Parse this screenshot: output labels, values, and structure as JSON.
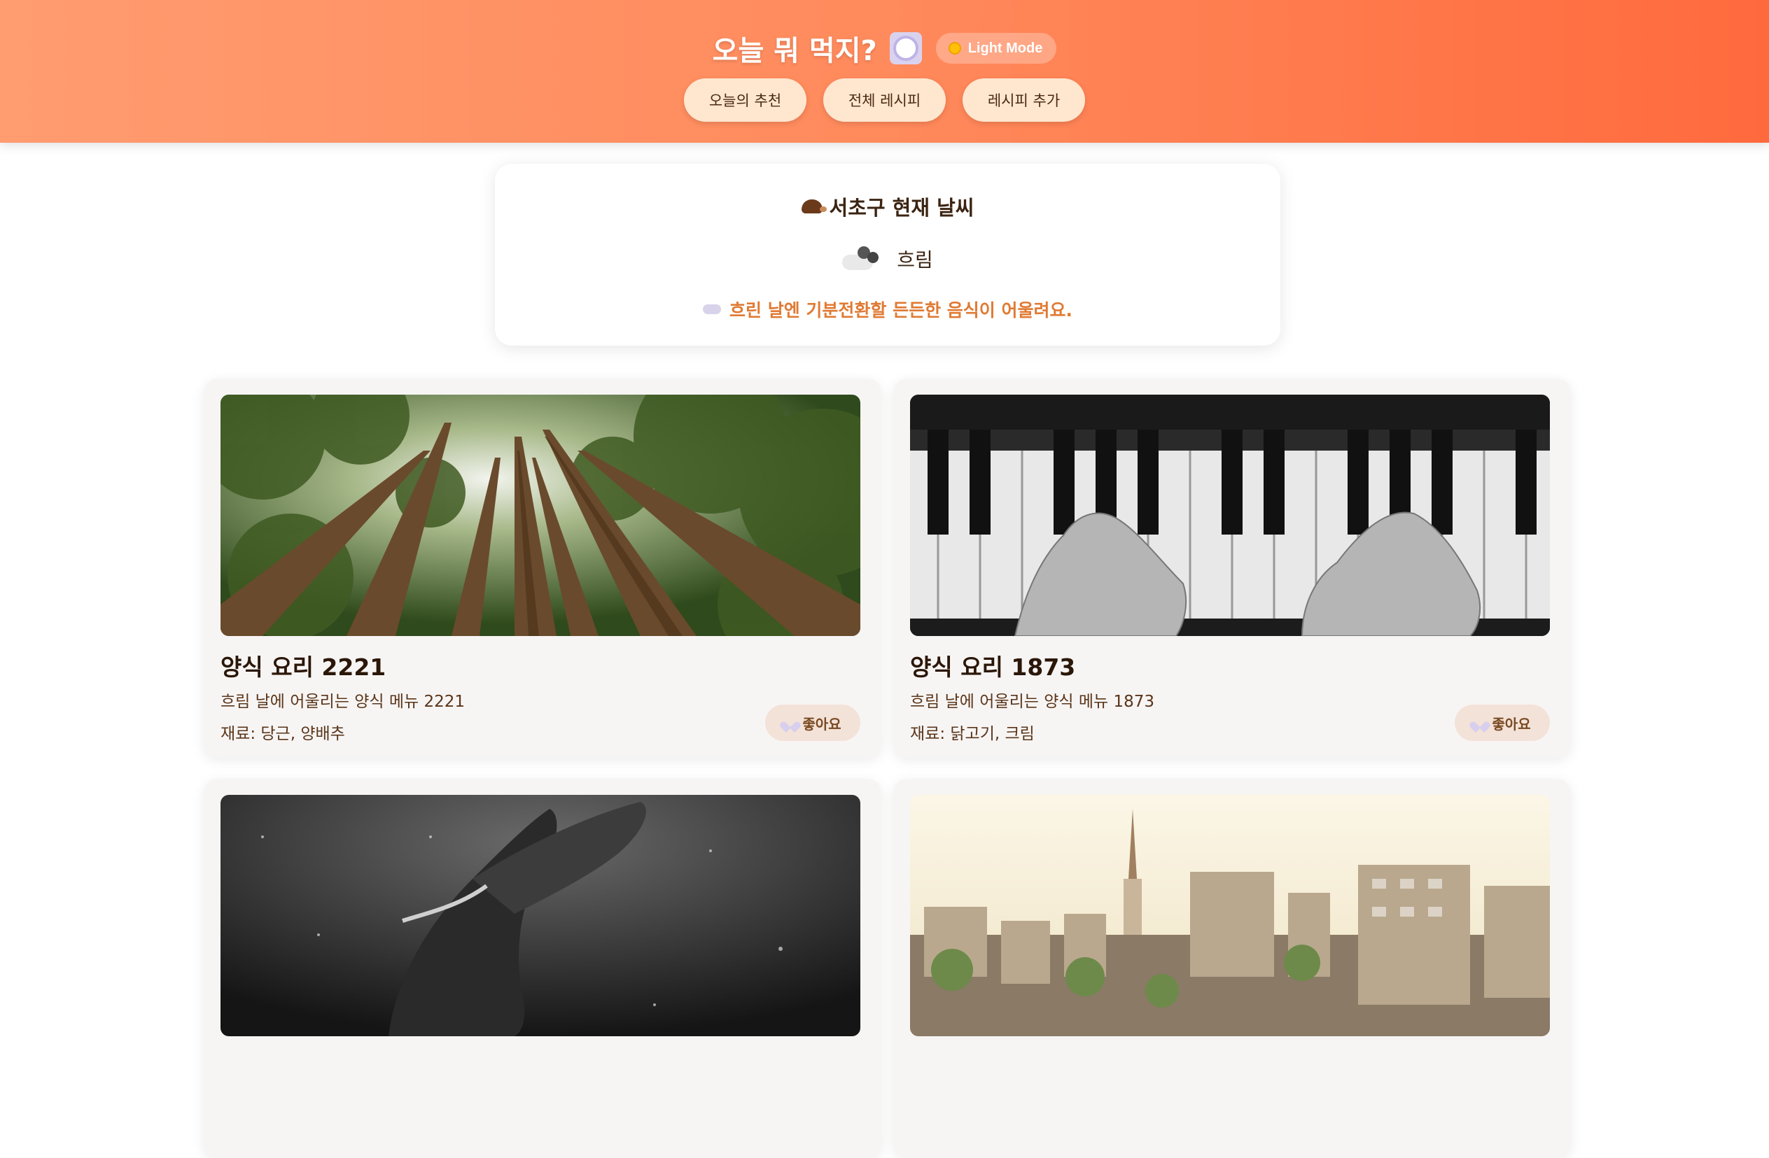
{
  "header": {
    "title": "오늘 뭐 먹지?",
    "title_icon": "plate-icon",
    "theme_toggle_label": "Light Mode",
    "theme_toggle_icon": "sun-icon",
    "nav": [
      {
        "label": "오늘의 추천"
      },
      {
        "label": "전체 레시피"
      },
      {
        "label": "레시피 추가"
      }
    ]
  },
  "weather": {
    "title": "서초구 현재 날씨",
    "title_icon": "hedgehog-icon",
    "status": "흐림",
    "status_icon": "cloud-icon",
    "message": "흐린 날엔 기분전환할 든든한 음식이 어울려요.",
    "message_icon": "cloud-icon"
  },
  "recipes": [
    {
      "title": "양식 요리 2221",
      "description": "흐림 날에 어울리는 양식 메뉴 2221",
      "ingredients": "재료: 당근, 양배추",
      "like_label": "좋아요",
      "image": "forest-canopy-photo"
    },
    {
      "title": "양식 요리 1873",
      "description": "흐림 날에 어울리는 양식 메뉴 1873",
      "ingredients": "재료: 닭고기, 크림",
      "like_label": "좋아요",
      "image": "piano-hands-photo"
    },
    {
      "title": "",
      "description": "",
      "ingredients": "",
      "like_label": "",
      "image": "underwater-person-photo"
    },
    {
      "title": "",
      "description": "",
      "ingredients": "",
      "like_label": "",
      "image": "city-church-photo"
    }
  ],
  "colors": {
    "header_gradient_start": "#ff9c70",
    "header_gradient_end": "#ff6a3d",
    "nav_button_bg": "#ffe6cf",
    "weather_message": "#e07a33",
    "card_bg": "#f7f5f4"
  }
}
